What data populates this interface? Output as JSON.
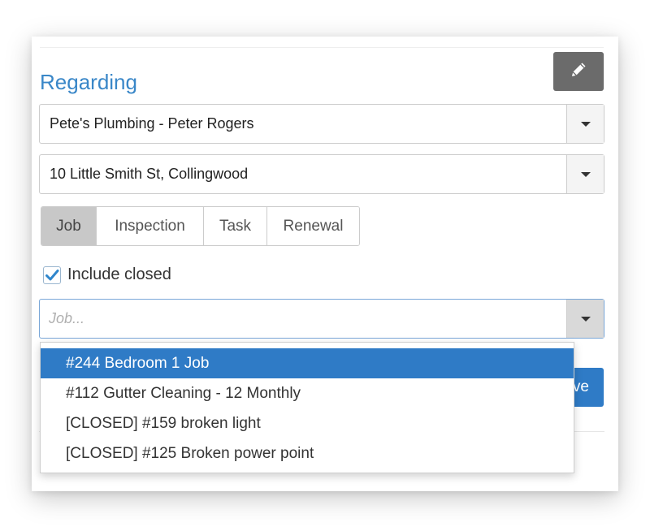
{
  "header": {
    "title": "Regarding",
    "edit_icon": "pencil-icon"
  },
  "contact_select": {
    "value": "Pete's Plumbing - Peter Rogers"
  },
  "property_select": {
    "value": "10 Little Smith St, Collingwood"
  },
  "type_tabs": [
    "Job",
    "Inspection",
    "Task",
    "Renewal"
  ],
  "active_tab": "Job",
  "include_closed": {
    "label": "Include closed",
    "checked": true
  },
  "job_search": {
    "placeholder": "Job...",
    "value": ""
  },
  "job_options": [
    "#244 Bedroom 1 Job",
    "#112 Gutter Cleaning - 12 Monthly",
    "[CLOSED] #159 broken light",
    "[CLOSED] #125 Broken power point"
  ],
  "selected_option": "#244 Bedroom 1 Job",
  "save_button": {
    "visible_label": "ve"
  },
  "colors": {
    "accent": "#2f7bc6",
    "title": "#3a87c8",
    "edit_button": "#6b6b6b",
    "active_tab": "#c8c8c8"
  }
}
